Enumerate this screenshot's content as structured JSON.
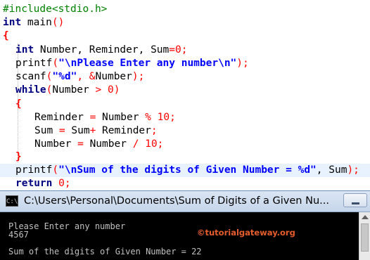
{
  "editor": {
    "line1": [
      "#include<stdio.h>"
    ],
    "line2": [
      "int",
      " main",
      "()"
    ],
    "line3": [
      "{"
    ],
    "line4": [
      "int",
      " Number, Reminder, Sum",
      "=",
      "0",
      ";"
    ],
    "line5": [
      "printf",
      "(",
      "\"\\nPlease Enter any number\\n\"",
      ");"
    ],
    "line6": [
      "scanf",
      "(",
      "\"%d\"",
      ", ",
      "&",
      "Number",
      ");"
    ],
    "line7": [
      "while",
      "(",
      "Number ",
      ">",
      " ",
      "0",
      ")"
    ],
    "line8": [
      "{"
    ],
    "line9": [
      "Reminder ",
      "=",
      " Number ",
      "%",
      " ",
      "10",
      ";"
    ],
    "line10": [
      "Sum ",
      "=",
      " Sum",
      "+",
      " Reminder",
      ";"
    ],
    "line11": [
      "Number ",
      "=",
      " Number ",
      "/",
      " ",
      "10",
      ";"
    ],
    "line12": [
      "}"
    ],
    "line13": [
      "printf",
      "(",
      "\"\\nSum of the digits of Given Number = %d\"",
      ", Sum",
      ");"
    ],
    "line14": [
      "return",
      " ",
      "0",
      ";"
    ]
  },
  "console": {
    "title": "C:\\Users\\Personal\\Documents\\Sum of Digits of a Given Nu...",
    "icon": "cmd-icon",
    "output": [
      "Please Enter any number",
      "4567",
      "",
      "Sum of the digits of Given Number = 22"
    ],
    "watermark": "©tutorialgateway.org"
  },
  "colors": {
    "keyword": "#000080",
    "string": "#0000ff",
    "preprocessor": "#008000",
    "number": "#ff0000",
    "highlight": "#e8f2fe",
    "console_bg": "#000000",
    "console_text": "#c0c0c0",
    "watermark": "#e65c2b"
  }
}
